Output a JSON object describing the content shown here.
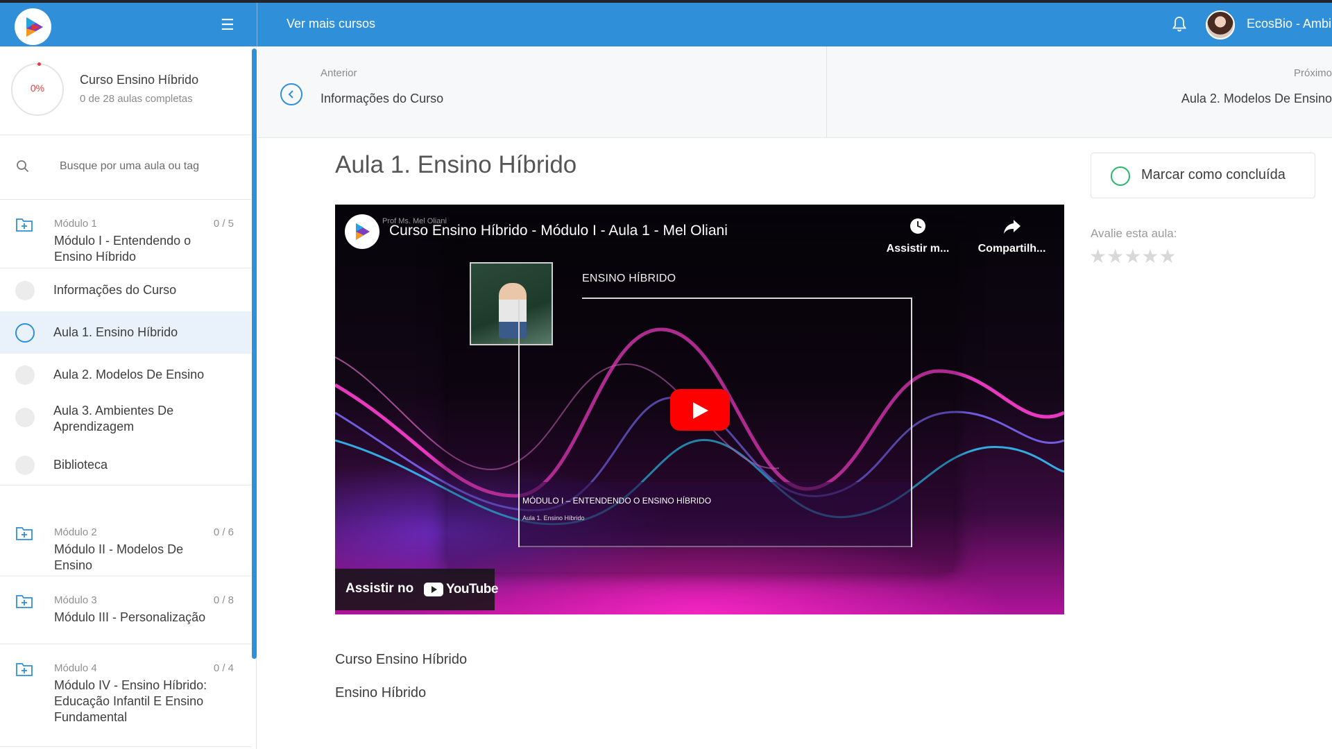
{
  "topbar": {
    "more_courses": "Ver mais cursos",
    "username": "EcosBio - Ambi",
    "accent": "#2f8fd8"
  },
  "sidebar": {
    "progress_pct": "0%",
    "progress_fraction": 0,
    "course_title": "Curso Ensino Híbrido",
    "course_sub": "0 de 28 aulas completas",
    "search_placeholder": "Busque por uma aula ou tag",
    "modules": [
      {
        "label": "Módulo 1",
        "count": "0 / 5",
        "title": "Módulo I - Entendendo o Ensino Híbrido"
      },
      {
        "label": "Módulo 2",
        "count": "0 / 6",
        "title": "Módulo II - Modelos De Ensino"
      },
      {
        "label": "Módulo 3",
        "count": "0 / 8",
        "title": "Módulo III - Personalização"
      },
      {
        "label": "Módulo 4",
        "count": "0 / 4",
        "title": "Módulo IV - Ensino Híbrido: Educação Infantil E Ensino Fundamental"
      }
    ],
    "lessons": [
      {
        "title": "Informações do Curso"
      },
      {
        "title": "Aula 1. Ensino Híbrido"
      },
      {
        "title": "Aula 2. Modelos De Ensino"
      },
      {
        "title": "Aula 3. Ambientes De Aprendizagem"
      },
      {
        "title": "Biblioteca"
      }
    ]
  },
  "nav": {
    "prev_label": "Anterior",
    "prev_title": "Informações do Curso",
    "next_label": "Próximo",
    "next_title": "Aula 2. Modelos De Ensino"
  },
  "content": {
    "lesson_title": "Aula 1. Ensino Híbrido",
    "mark_complete": "Marcar como concluída",
    "rate_label": "Avalie esta aula:",
    "rating": 0,
    "rating_max": 5,
    "footer_1": "Curso Ensino Híbrido",
    "footer_2": "Ensino Híbrido"
  },
  "video": {
    "channel_small": "Prof Ms. Mel Oliani",
    "title": "Curso Ensino Híbrido - Módulo I - Aula 1 - Mel Oliani",
    "watch_later": "Assistir m...",
    "share": "Compartilh...",
    "slide_heading": "ENSINO HÍBRIDO",
    "caption_1": "MÓDULO I – ENTENDENDO O ENSINO HÍBRIDO",
    "caption_2": "Aula 1. Ensino Híbrido",
    "watch_on": "Assistir no",
    "yt_brand": "YouTube"
  }
}
